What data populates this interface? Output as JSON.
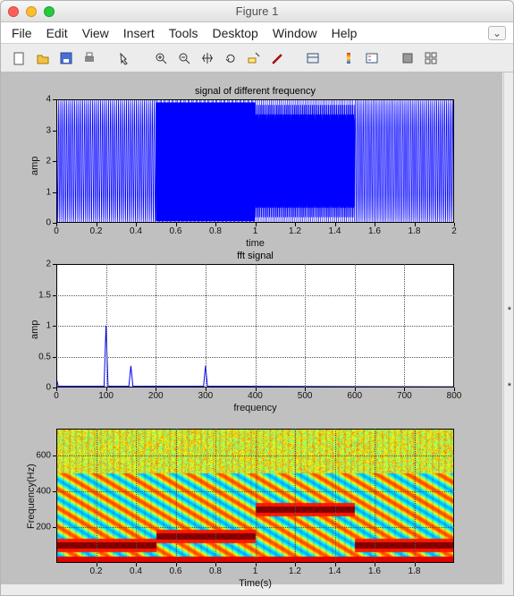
{
  "window": {
    "title": "Figure 1"
  },
  "traffic": {
    "close": "close",
    "min": "minimize",
    "max": "zoom"
  },
  "menu": {
    "file": "File",
    "edit": "Edit",
    "view": "View",
    "insert": "Insert",
    "tools": "Tools",
    "desktop": "Desktop",
    "window": "Window",
    "help": "Help",
    "chev": "⌄"
  },
  "toolbar": {
    "icons": [
      "new",
      "open",
      "save",
      "print",
      "arrow",
      "zoomin",
      "zoomout",
      "pan",
      "rotate",
      "cursor",
      "brush",
      "link",
      "colorbar",
      "legend",
      "dock",
      "undo"
    ]
  },
  "chart_data": [
    {
      "id": "signal",
      "type": "line",
      "title": "signal of different frequency",
      "xlabel": "time",
      "ylabel": "amp",
      "xlim": [
        0,
        2
      ],
      "ylim": [
        0,
        4
      ],
      "xticks": [
        0,
        0.2,
        0.4,
        0.6,
        0.8,
        1,
        1.2,
        1.4,
        1.6,
        1.8,
        2
      ],
      "yticks": [
        0,
        1,
        2,
        3,
        4
      ],
      "note": "time-domain signal composed of 4 concatenated segments with different frequencies, amplitude approx 0–4",
      "segments": [
        {
          "t_range": [
            0.0,
            0.5
          ],
          "freq_hz": 100,
          "amp": 2,
          "offset": 2
        },
        {
          "t_range": [
            0.5,
            1.0
          ],
          "freq_hz": 150,
          "amp": 2,
          "offset": 2
        },
        {
          "t_range": [
            1.0,
            1.5
          ],
          "freq_hz": 300,
          "amp": 2,
          "offset": 2
        },
        {
          "t_range": [
            1.5,
            2.0
          ],
          "freq_hz": 100,
          "amp": 2,
          "offset": 2
        }
      ]
    },
    {
      "id": "fft",
      "type": "line",
      "title": "fft signal",
      "xlabel": "frequency",
      "ylabel": "amp",
      "xlim": [
        0,
        800
      ],
      "ylim": [
        0,
        2
      ],
      "xticks": [
        0,
        100,
        200,
        300,
        400,
        500,
        600,
        700,
        800
      ],
      "yticks": [
        0,
        0.5,
        1,
        1.5,
        2
      ],
      "peaks": [
        {
          "freq": 0,
          "amp": 0.15
        },
        {
          "freq": 100,
          "amp": 1.0
        },
        {
          "freq": 150,
          "amp": 0.35
        },
        {
          "freq": 300,
          "amp": 0.35
        }
      ]
    },
    {
      "id": "spectrogram",
      "type": "heatmap",
      "title": "",
      "xlabel": "Time(s)",
      "ylabel": "Frequency(Hz)",
      "xlim": [
        0,
        2
      ],
      "ylim": [
        0,
        750
      ],
      "xticks": [
        0.2,
        0.4,
        0.6,
        0.8,
        1,
        1.2,
        1.4,
        1.6,
        1.8
      ],
      "yticks": [
        200,
        400,
        600
      ],
      "dominant_bands": [
        {
          "t_range": [
            0.0,
            0.5
          ],
          "freq": 100
        },
        {
          "t_range": [
            0.5,
            1.0
          ],
          "freq": 150
        },
        {
          "t_range": [
            1.0,
            1.5
          ],
          "freq": 300
        },
        {
          "t_range": [
            1.5,
            2.0
          ],
          "freq": 100
        }
      ],
      "colormap": "jet-like (dark red low energy outside band → yellow → bright red at dominant freq; blue/green speckle at high freqs)"
    }
  ],
  "misc": {
    "star": "*"
  }
}
